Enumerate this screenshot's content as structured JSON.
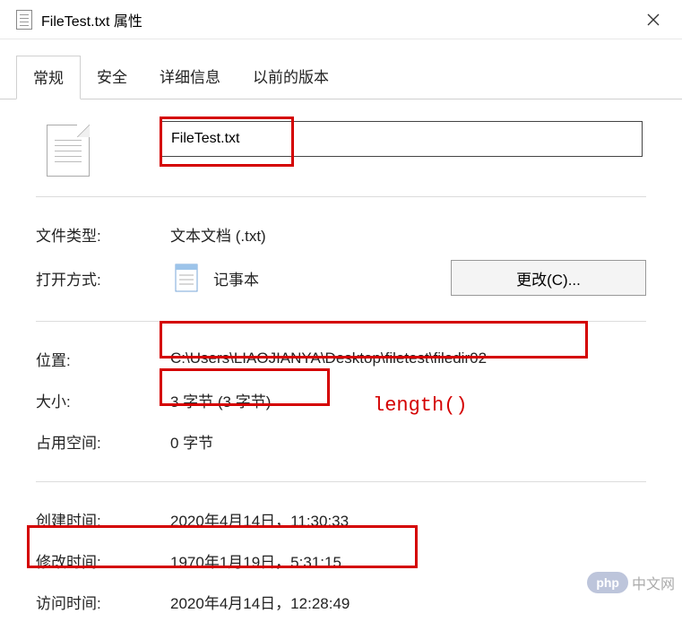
{
  "title": "FileTest.txt 属性",
  "tabs": {
    "general": "常规",
    "security": "安全",
    "details": "详细信息",
    "previous": "以前的版本"
  },
  "filename": "FileTest.txt",
  "props": {
    "filetype_label": "文件类型:",
    "filetype_value": "文本文档 (.txt)",
    "openwith_label": "打开方式:",
    "openwith_value": "记事本",
    "change_btn": "更改(C)...",
    "location_label": "位置:",
    "location_value": "C:\\Users\\LIAOJIANYA\\Desktop\\filetest\\filedir02",
    "size_label": "大小:",
    "size_value": "3 字节 (3 字节)",
    "disk_label": "占用空间:",
    "disk_value": "0 字节",
    "created_label": "创建时间:",
    "created_value": "2020年4月14日，11:30:33",
    "modified_label": "修改时间:",
    "modified_value": "1970年1月19日，5:31:15",
    "accessed_label": "访问时间:",
    "accessed_value": "2020年4月14日，12:28:49"
  },
  "annotation": "length()",
  "badge": {
    "oval": "php",
    "cn": "中文网"
  }
}
